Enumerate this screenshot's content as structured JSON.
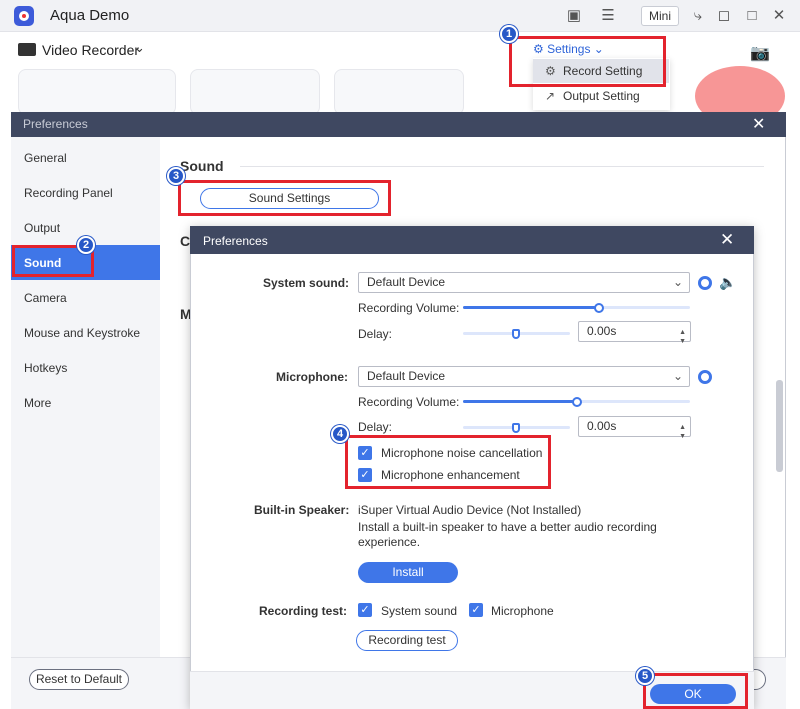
{
  "app": {
    "title": "Aqua Demo",
    "mini_label": "Mini"
  },
  "toolbar": {
    "video_recorder_label": "Video Recorder",
    "settings_label": "Settings"
  },
  "settings_menu": {
    "record_setting": "Record Setting",
    "output_setting": "Output Setting"
  },
  "prefs": {
    "title": "Preferences",
    "sidebar": [
      "General",
      "Recording Panel",
      "Output",
      "Sound",
      "Camera",
      "Mouse and Keystroke",
      "Hotkeys",
      "More"
    ],
    "selected": "Sound",
    "section_title": "Sound",
    "sound_settings_button": "Sound Settings",
    "reset_button": "Reset to Default",
    "bg_heading_c": "C",
    "bg_heading_m": "M"
  },
  "sound_dialog": {
    "title": "Preferences",
    "system_sound": {
      "label": "System sound:",
      "device": "Default Device",
      "volume_label": "Recording Volume:",
      "volume_level": 0.6,
      "delay_label": "Delay:",
      "delay_value": "0.00s"
    },
    "microphone": {
      "label": "Microphone:",
      "device": "Default Device",
      "volume_label": "Recording Volume:",
      "volume_level": 0.5,
      "delay_label": "Delay:",
      "delay_value": "0.00s",
      "noise_cancellation": "Microphone noise cancellation",
      "enhancement": "Microphone enhancement"
    },
    "builtin_speaker": {
      "label": "Built-in Speaker:",
      "device": "iSuper Virtual Audio Device (Not Installed)",
      "description": "Install a built-in speaker to have a better audio recording experience.",
      "install_button": "Install"
    },
    "recording_test": {
      "label": "Recording test:",
      "system_sound": "System sound",
      "microphone": "Microphone",
      "button": "Recording test"
    },
    "ok_button": "OK"
  },
  "badges": [
    "1",
    "2",
    "3",
    "4",
    "5"
  ],
  "colors": {
    "accent": "#3f76e8",
    "titlebar": "#3f4861",
    "annotation": "#e3232d",
    "badge": "#2758c7"
  }
}
